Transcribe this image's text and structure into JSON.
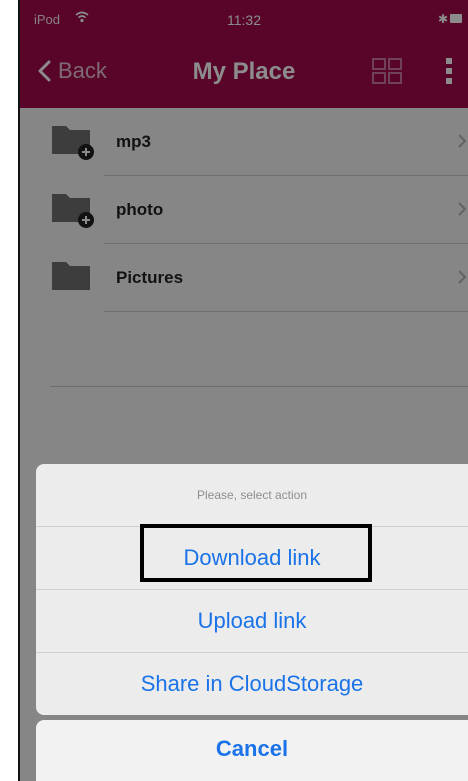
{
  "status_bar": {
    "carrier": "iPod",
    "time": "11:32"
  },
  "nav": {
    "back_label": "Back",
    "title": "My Place"
  },
  "folders": [
    {
      "name": "mp3"
    },
    {
      "name": "photo"
    },
    {
      "name": "Pictures"
    }
  ],
  "action_sheet": {
    "prompt": "Please, select action",
    "actions": [
      "Download link",
      "Upload link",
      "Share in CloudStorage"
    ],
    "cancel": "Cancel"
  },
  "colors": {
    "nav_bg": "#a30a4e",
    "action_text": "#1a73e8",
    "highlight_border": "#000000"
  }
}
